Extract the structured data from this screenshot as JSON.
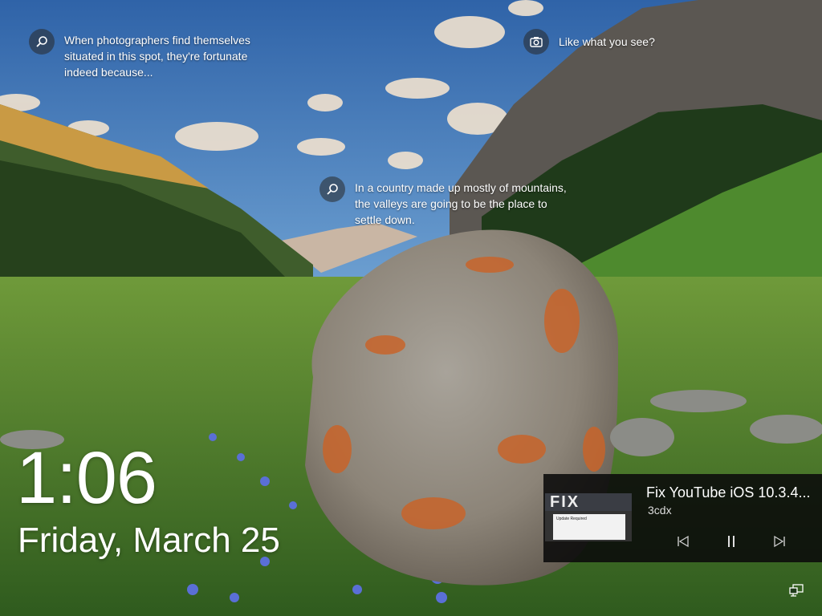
{
  "hotspots": [
    {
      "text": "When photographers find themselves situated in this spot, they're fortunate indeed because...",
      "icon": "search-icon"
    },
    {
      "text": "Like what you see?",
      "icon": "camera-icon"
    },
    {
      "text": "In a country made up mostly of mountains, the valleys are going to be the place to settle down.",
      "icon": "search-icon"
    }
  ],
  "clock": {
    "time": "1:06",
    "date": "Friday, March 25"
  },
  "media": {
    "title": "Fix YouTube iOS 10.3.4...",
    "artist": "3cdx",
    "thumbnail_text": "FIX",
    "thumbnail_dialog": "Update Required",
    "controls": [
      "previous-icon",
      "pause-icon",
      "next-icon"
    ]
  },
  "tray": {
    "icon": "network-icon"
  }
}
